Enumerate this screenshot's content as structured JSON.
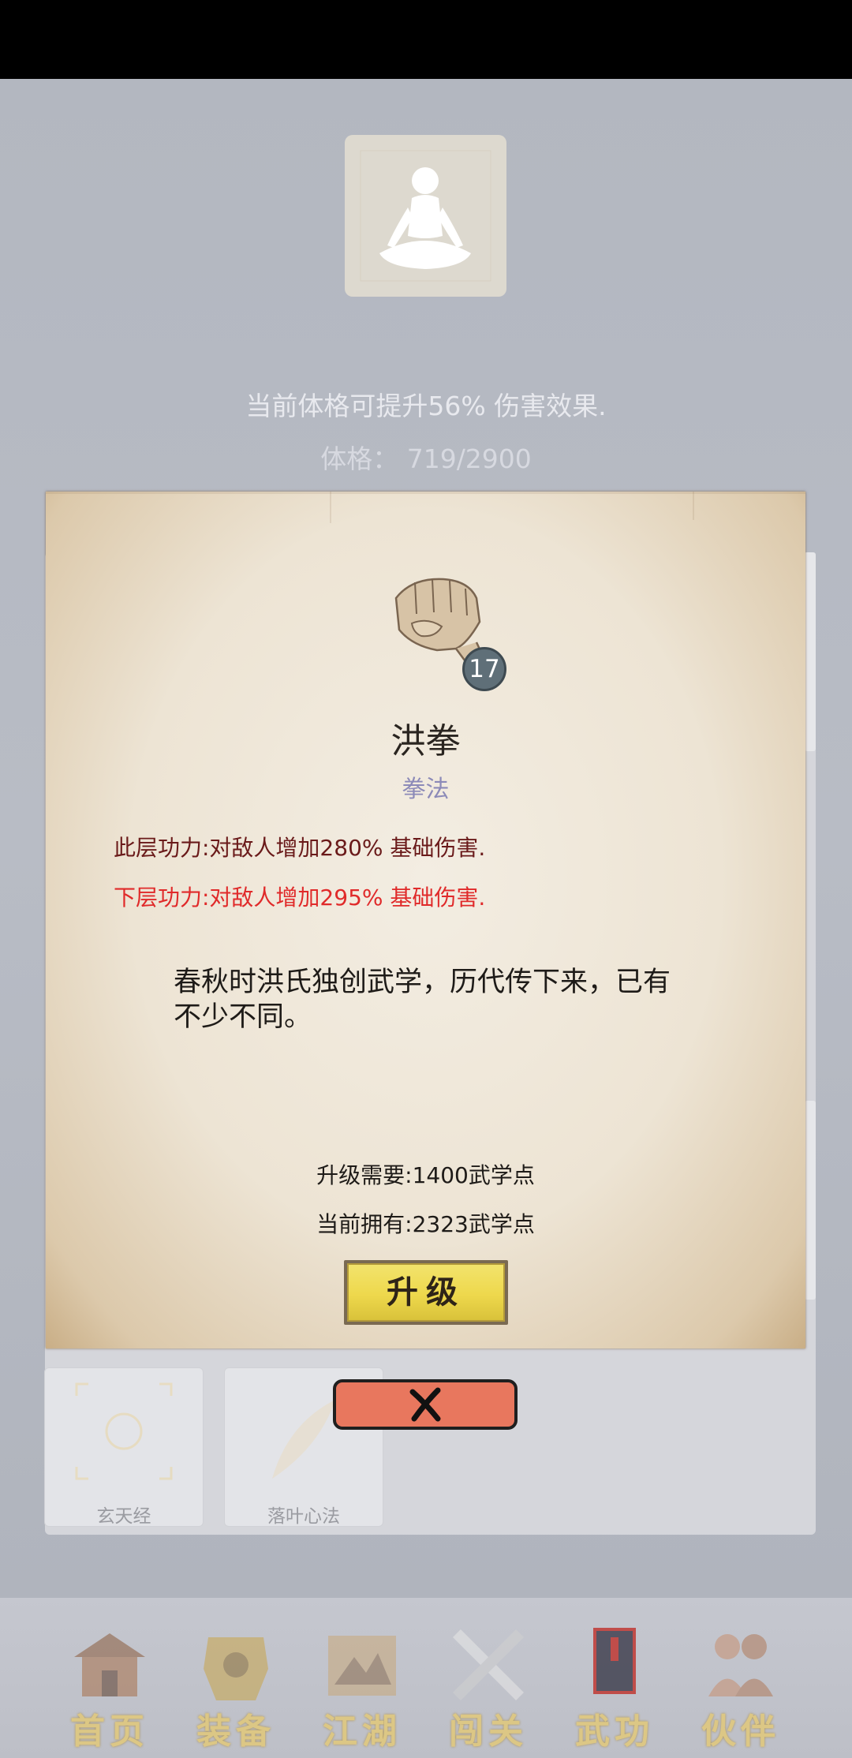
{
  "header": {
    "avatar_icon": "meditating-figure-icon",
    "damage_desc": "当前体格可提升56% 伤害效果.",
    "constitution_label": "体格：",
    "constitution_value": "719/2900"
  },
  "skill_list": [
    {
      "name": "玄天经",
      "icon": "scroll-seal-icon"
    },
    {
      "name": "落叶心法",
      "icon": "feather-icon"
    }
  ],
  "popup": {
    "icon": "fist-icon",
    "level": "17",
    "name": "洪拳",
    "type": "拳法",
    "current_effect": "此层功力:对敌人增加280% 基础伤害.",
    "next_effect": "下层功力:对敌人增加295% 基础伤害.",
    "lore": "春秋时洪氏独创武学，历代传下来，已有不少不同。",
    "upgrade_cost": "升级需要:1400武学点",
    "points_owned": "当前拥有:2323武学点",
    "upgrade_label": "升级",
    "close_icon": "close-x-icon"
  },
  "nav": [
    {
      "label": "首页",
      "icon": "home-icon"
    },
    {
      "label": "装备",
      "icon": "armor-icon"
    },
    {
      "label": "江湖",
      "icon": "map-scroll-icon"
    },
    {
      "label": "闯关",
      "icon": "crossed-swords-icon"
    },
    {
      "label": "武功",
      "icon": "martial-book-icon"
    },
    {
      "label": "伙伴",
      "icon": "companions-icon"
    }
  ],
  "colors": {
    "next_effect": "#e02a2a",
    "current_effect": "#6a1a1a",
    "skill_type": "#8c8ab8",
    "upgrade_button": "#eed84c",
    "close_button": "#e8775e"
  }
}
